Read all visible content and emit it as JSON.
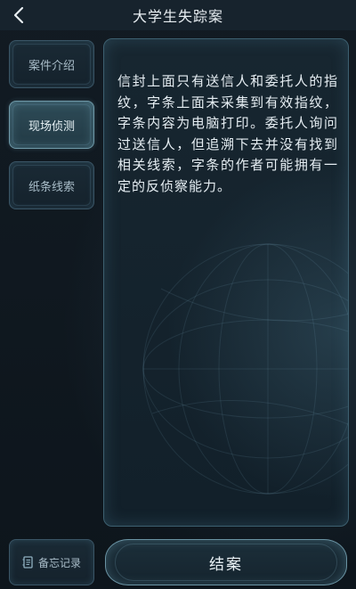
{
  "header": {
    "title": "大学生失踪案",
    "back_icon": "chevron-left-icon"
  },
  "sidebar": {
    "items": [
      {
        "label": "案件介绍",
        "active": false
      },
      {
        "label": "现场侦测",
        "active": true
      },
      {
        "label": "纸条线索",
        "active": false
      }
    ]
  },
  "panel": {
    "text": "信封上面只有送信人和委托人的指纹，字条上面未采集到有效指纹，字条内容为电脑打印。委托人询问过送信人，但追溯下去并没有找到相关线索，字条的作者可能拥有一定的反侦察能力。"
  },
  "footer": {
    "memo_label": "备忘记录",
    "memo_icon": "notebook-icon",
    "close_case_label": "结案"
  }
}
